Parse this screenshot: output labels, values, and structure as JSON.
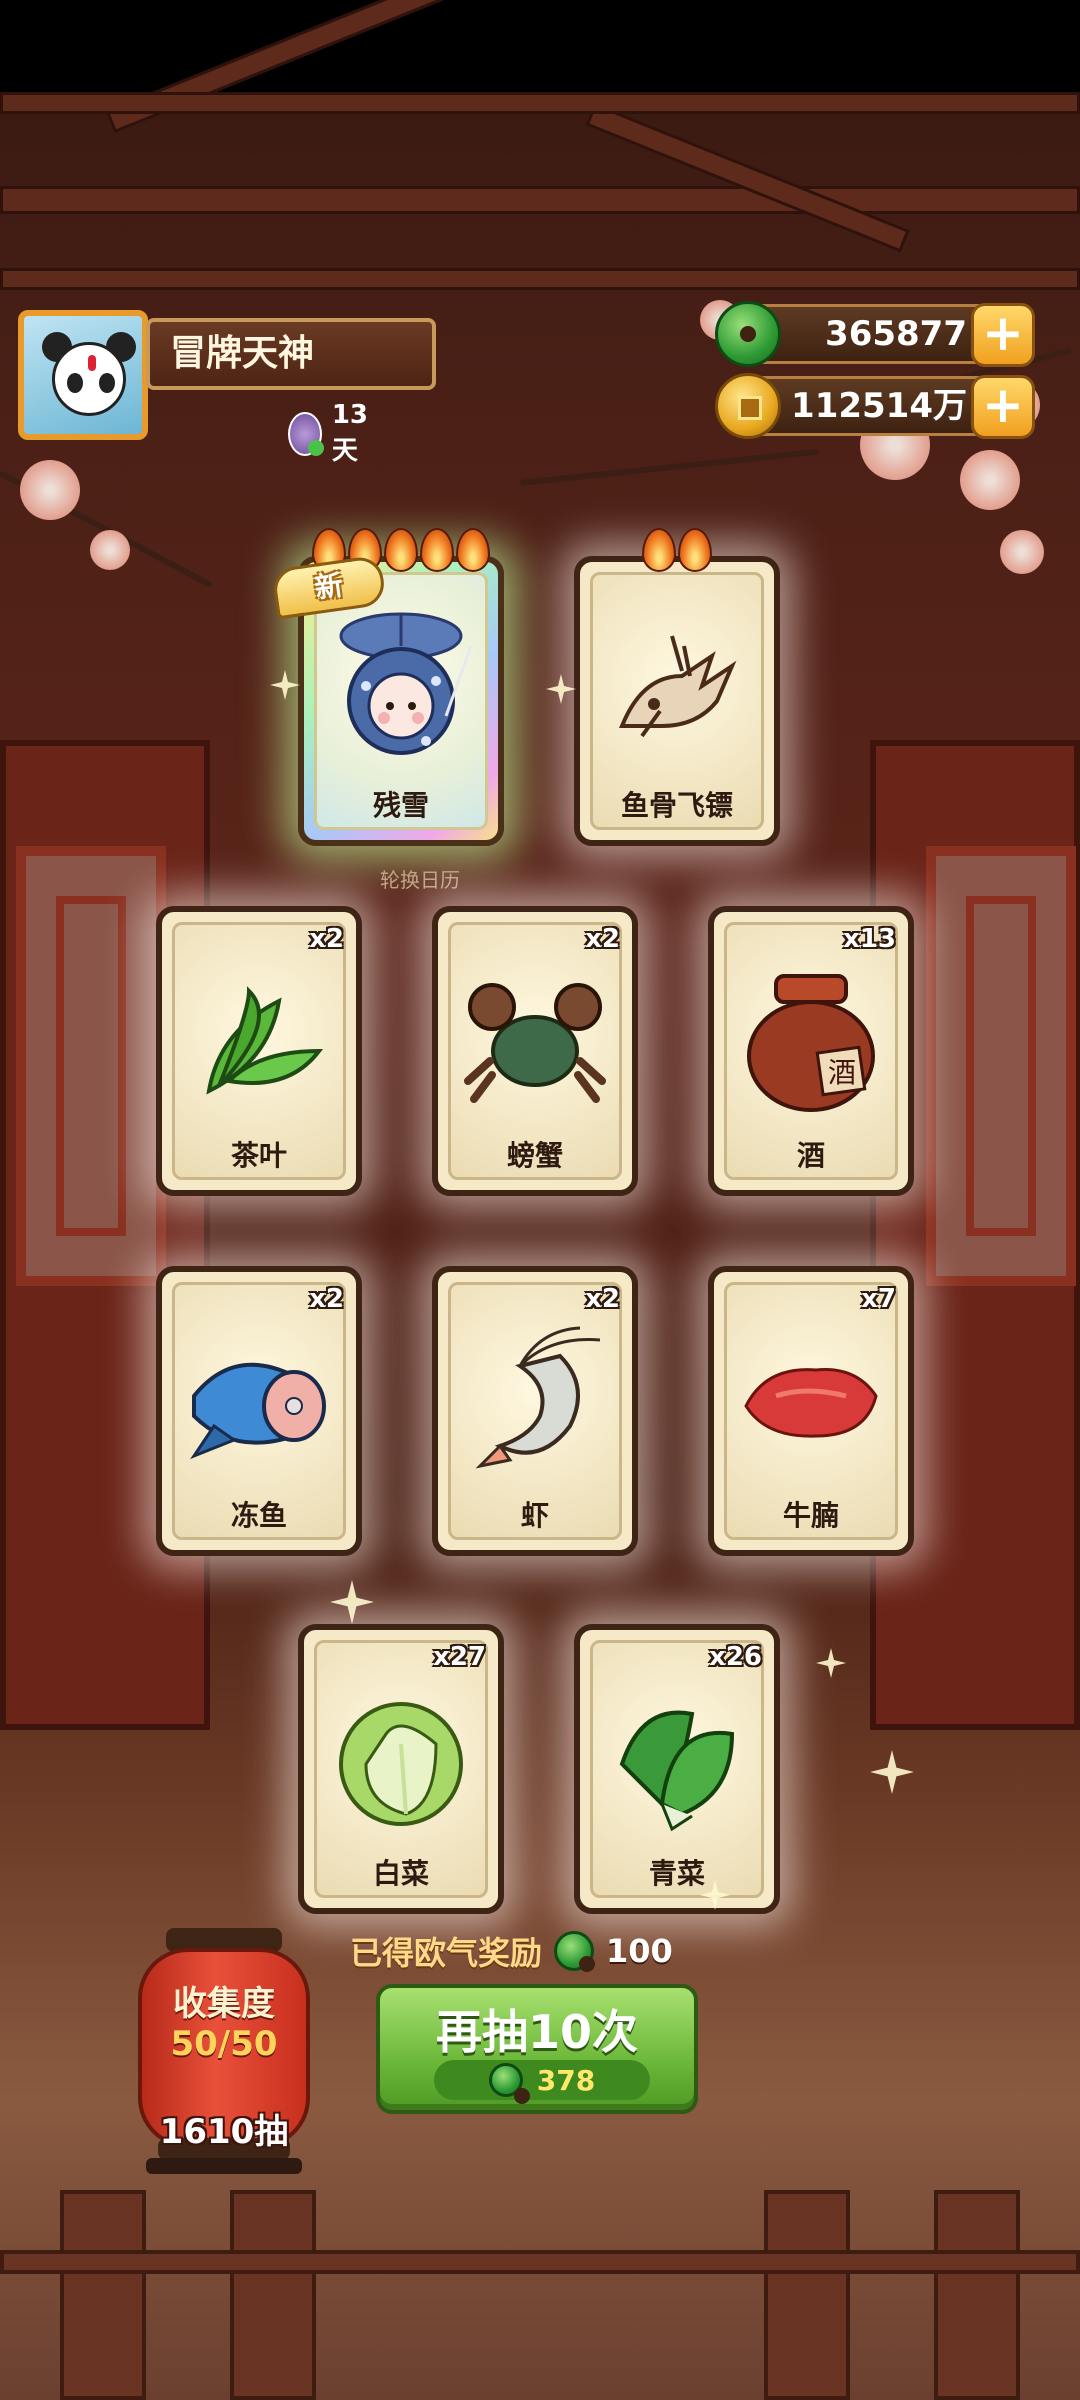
{
  "player": {
    "name": "冒牌天神",
    "days": "13天"
  },
  "currencies": [
    {
      "icon": "jade-icon",
      "value": "365877"
    },
    {
      "icon": "coin-icon",
      "value": "112514万"
    }
  ],
  "featured_cards": [
    {
      "label": "残雪",
      "flames": 5,
      "is_new": true,
      "new_text": "新"
    },
    {
      "label": "鱼骨飞镖",
      "flames": 2,
      "is_new": false
    }
  ],
  "caption": "轮换日历",
  "item_cards": [
    {
      "label": "茶叶",
      "count": "x2",
      "icon": "tea-leaf-icon"
    },
    {
      "label": "螃蟹",
      "count": "x2",
      "icon": "crab-icon"
    },
    {
      "label": "酒",
      "count": "x13",
      "icon": "wine-jar-icon",
      "jar_text": "酒"
    },
    {
      "label": "冻鱼",
      "count": "x2",
      "icon": "frozen-fish-icon"
    },
    {
      "label": "虾",
      "count": "x2",
      "icon": "shrimp-icon"
    },
    {
      "label": "牛腩",
      "count": "x7",
      "icon": "beef-icon"
    },
    {
      "label": "白菜",
      "count": "x27",
      "icon": "cabbage-icon"
    },
    {
      "label": "青菜",
      "count": "x26",
      "icon": "greens-icon"
    }
  ],
  "bonus": {
    "text": "已得欧气奖励",
    "amount": "100"
  },
  "collection": {
    "title": "收集度",
    "progress": "50/50",
    "draws": "1610抽"
  },
  "draw_button": {
    "label": "再抽10次",
    "cost": "378"
  },
  "colors": {
    "accent_green": "#6cb83a",
    "jade": "#2e9a34",
    "gold": "#e8a820",
    "card_bg": "#f6e9c8",
    "lantern_red": "#e8503a"
  }
}
